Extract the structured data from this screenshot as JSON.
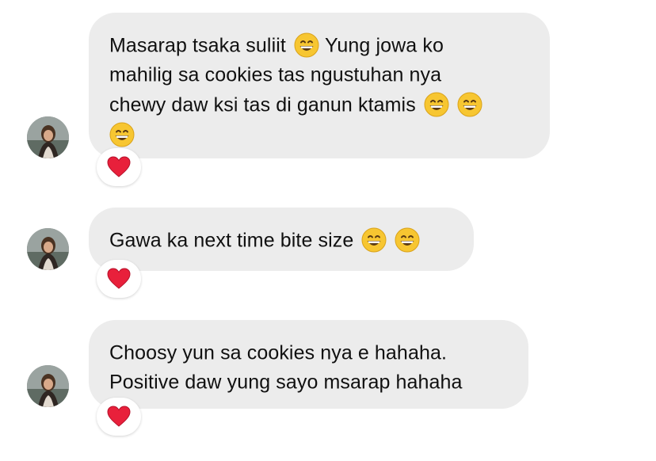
{
  "messages": [
    {
      "lines": [
        {
          "text": "Masarap tsaka suliit",
          "emojis_after": [
            "grinning-face-with-smiling-eyes"
          ],
          "trail": "Yung jowa ko"
        },
        {
          "text": "mahilig sa cookies tas ngustuhan nya"
        },
        {
          "text": "chewy daw ksi tas di ganun ktamis",
          "emojis_after": [
            "grinning-face-with-smiling-eyes",
            "grinning-face-with-smiling-eyes"
          ]
        },
        {
          "text": "",
          "emojis_after": [
            "grinning-face-with-smiling-eyes"
          ]
        }
      ],
      "reaction": "red-heart"
    },
    {
      "lines": [
        {
          "text": "Gawa ka next time bite size",
          "emojis_after": [
            "grinning-face-with-smiling-eyes",
            "grinning-face-with-smiling-eyes"
          ]
        }
      ],
      "reaction": "red-heart"
    },
    {
      "lines": [
        {
          "text": "Choosy yun sa cookies nya e hahaha."
        },
        {
          "text": "Positive daw yung sayo msarap hahaha"
        }
      ],
      "reaction": "red-heart"
    }
  ],
  "colors": {
    "bubble": "#ececec",
    "text": "#101010",
    "heart": "#e8203b",
    "emoji_face": "#f7c631"
  }
}
